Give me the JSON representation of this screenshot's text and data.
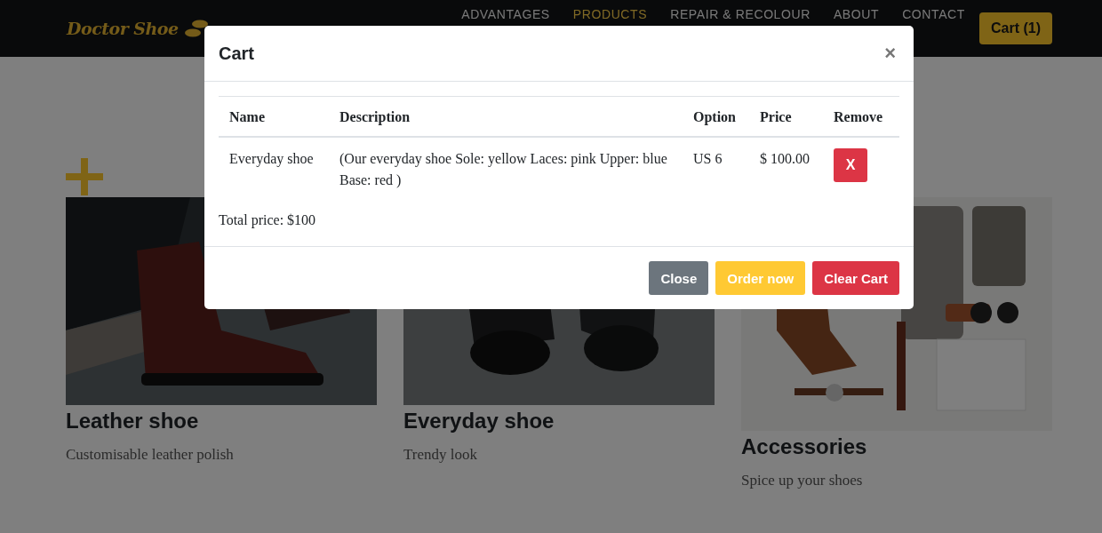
{
  "navbar": {
    "logo": "Doctor Shoe",
    "links": [
      {
        "label": "ADVANTAGES",
        "selected": false
      },
      {
        "label": "PRODUCTS",
        "selected": true
      },
      {
        "label": "REPAIR & RECOLOUR",
        "selected": false
      },
      {
        "label": "ABOUT",
        "selected": false
      },
      {
        "label": "CONTACT",
        "selected": false
      }
    ],
    "cart_button": "Cart (1)"
  },
  "products": [
    {
      "title": "Leather shoe",
      "description": "Customisable leather polish"
    },
    {
      "title": "Everyday shoe",
      "description": "Trendy look"
    },
    {
      "title": "Accessories",
      "description": "Spice up your shoes"
    }
  ],
  "modal": {
    "title": "Cart",
    "close": "×",
    "table": {
      "columns": [
        "Name",
        "Description",
        "Option",
        "Price",
        "Remove"
      ],
      "rows": [
        {
          "name": "Everyday shoe",
          "description": "(Our everyday shoe Sole: yellow Laces: pink Upper: blue Base: red )",
          "option": "US 6",
          "price": "$ 100.00",
          "remove": "X"
        }
      ]
    },
    "total": "Total price: $100",
    "buttons": [
      {
        "label": "Close",
        "kind": "secondary"
      },
      {
        "label": "Order now",
        "kind": "warning"
      },
      {
        "label": "Clear Cart",
        "kind": "danger"
      }
    ]
  }
}
